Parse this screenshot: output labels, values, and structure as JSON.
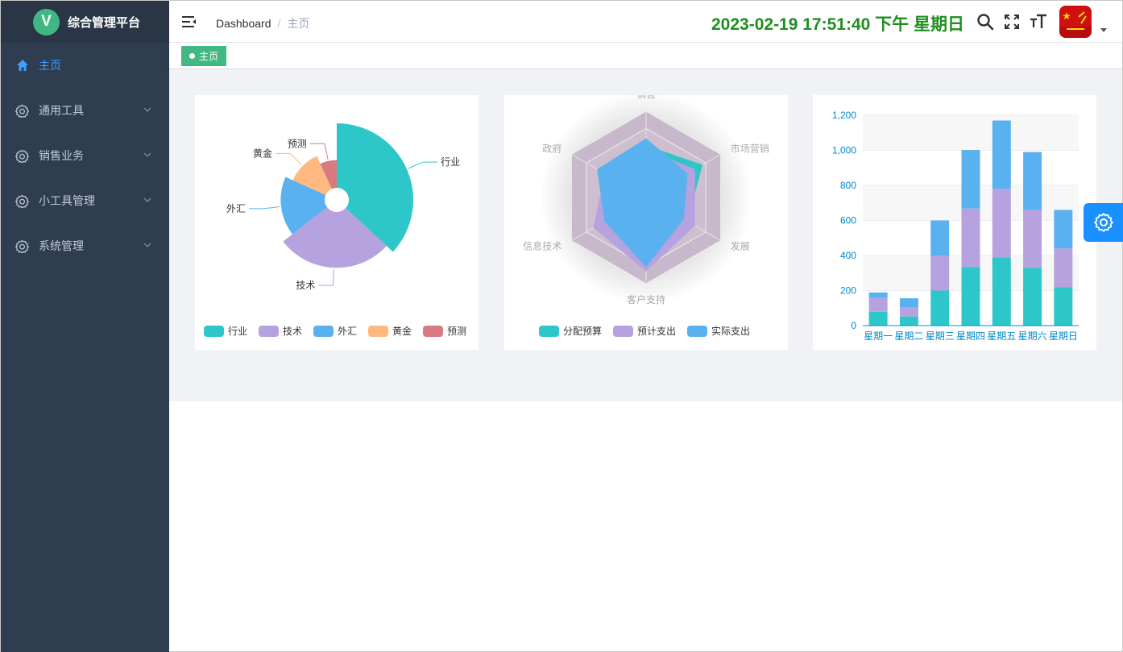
{
  "app": {
    "title": "综合管理平台",
    "logo_letter": "V"
  },
  "sidebar": {
    "items": [
      {
        "label": "主页",
        "icon": "home-icon",
        "active": true
      },
      {
        "label": "通用工具",
        "icon": "gear-icon",
        "active": false
      },
      {
        "label": "销售业务",
        "icon": "gear-icon",
        "active": false
      },
      {
        "label": "小工具管理",
        "icon": "gear-icon",
        "active": false
      },
      {
        "label": "系统管理",
        "icon": "gear-icon",
        "active": false
      }
    ]
  },
  "navbar": {
    "breadcrumb": [
      "Dashboard",
      "主页"
    ],
    "datetime": "2023-02-19 17:51:40 下午 星期日"
  },
  "tags": {
    "active": "主页"
  },
  "colors": {
    "teal": "#2ec7c9",
    "purple": "#b6a2de",
    "blue": "#5ab1ef",
    "orange": "#ffb980",
    "red": "#d87a80",
    "accent": "#409eff",
    "green": "#42b983"
  },
  "charts": [
    {
      "type": "pie",
      "roseType": "radius",
      "categories": [
        "行业",
        "技术",
        "外汇",
        "黄金",
        "预测"
      ],
      "values": [
        320,
        240,
        149,
        100,
        59
      ],
      "legend": [
        "行业",
        "技术",
        "外汇",
        "黄金",
        "预测"
      ]
    },
    {
      "type": "radar",
      "indicators": [
        "销售",
        "市场营销",
        "发展",
        "客户支持",
        "信息技术",
        "政府"
      ],
      "max": 100,
      "series": [
        {
          "name": "分配预算",
          "values": [
            60,
            75,
            55,
            85,
            50,
            60
          ]
        },
        {
          "name": "预计支出",
          "values": [
            55,
            65,
            65,
            85,
            70,
            55
          ]
        },
        {
          "name": "实际支出",
          "values": [
            68,
            55,
            50,
            80,
            55,
            65
          ]
        }
      ],
      "legend": [
        "分配预算",
        "预计支出",
        "实际支出"
      ]
    },
    {
      "type": "bar",
      "stacked": true,
      "categories": [
        "星期一",
        "星期二",
        "星期三",
        "星期四",
        "星期五",
        "星期六",
        "星期日"
      ],
      "series": [
        {
          "values": [
            79,
            52,
            200,
            334,
            390,
            330,
            220
          ]
        },
        {
          "values": [
            80,
            52,
            200,
            334,
            390,
            330,
            220
          ]
        },
        {
          "values": [
            30,
            52,
            200,
            334,
            390,
            330,
            220
          ]
        }
      ],
      "ylim": [
        0,
        1200
      ],
      "yticks": [
        "0",
        "200",
        "400",
        "600",
        "800",
        "1,000",
        "1,200"
      ]
    }
  ]
}
